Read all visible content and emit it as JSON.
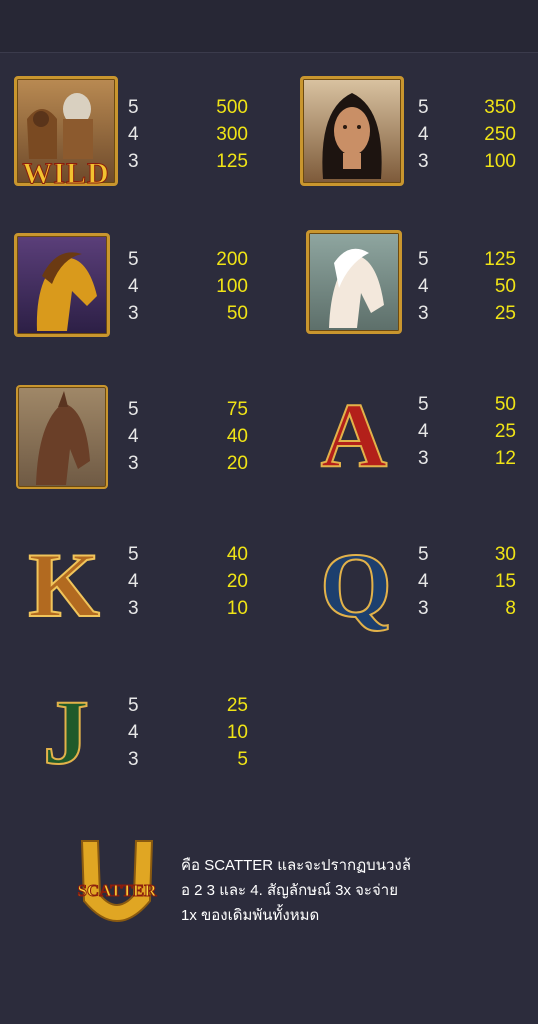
{
  "symbols": [
    {
      "name": "wild",
      "caption": "WILD",
      "pays": [
        {
          "count": "5",
          "value": "500"
        },
        {
          "count": "4",
          "value": "300"
        },
        {
          "count": "3",
          "value": "125"
        }
      ]
    },
    {
      "name": "woman",
      "pays": [
        {
          "count": "5",
          "value": "350"
        },
        {
          "count": "4",
          "value": "250"
        },
        {
          "count": "3",
          "value": "100"
        }
      ]
    },
    {
      "name": "golden-horse",
      "pays": [
        {
          "count": "5",
          "value": "200"
        },
        {
          "count": "4",
          "value": "100"
        },
        {
          "count": "3",
          "value": "50"
        }
      ]
    },
    {
      "name": "white-horse",
      "pays": [
        {
          "count": "5",
          "value": "125"
        },
        {
          "count": "4",
          "value": "50"
        },
        {
          "count": "3",
          "value": "25"
        }
      ]
    },
    {
      "name": "brown-horse",
      "pays": [
        {
          "count": "5",
          "value": "75"
        },
        {
          "count": "4",
          "value": "40"
        },
        {
          "count": "3",
          "value": "20"
        }
      ]
    },
    {
      "name": "letter-a",
      "glyph": "A",
      "pays": [
        {
          "count": "5",
          "value": "50"
        },
        {
          "count": "4",
          "value": "25"
        },
        {
          "count": "3",
          "value": "12"
        }
      ]
    },
    {
      "name": "letter-k",
      "glyph": "K",
      "pays": [
        {
          "count": "5",
          "value": "40"
        },
        {
          "count": "4",
          "value": "20"
        },
        {
          "count": "3",
          "value": "10"
        }
      ]
    },
    {
      "name": "letter-q",
      "glyph": "Q",
      "pays": [
        {
          "count": "5",
          "value": "30"
        },
        {
          "count": "4",
          "value": "15"
        },
        {
          "count": "3",
          "value": "8"
        }
      ]
    },
    {
      "name": "letter-j",
      "glyph": "J",
      "pays": [
        {
          "count": "5",
          "value": "25"
        },
        {
          "count": "4",
          "value": "10"
        },
        {
          "count": "3",
          "value": "5"
        }
      ]
    }
  ],
  "scatter": {
    "caption": "SCATTER",
    "lines": [
      "คือ SCATTER และจะปรากฏบนวงล้",
      "อ 2 3 และ 4. สัญลักษณ์ 3x จะจ่าย",
      "1x ของเดิมพันทั้งหมด"
    ]
  },
  "colors": {
    "background": "#2c2c3c",
    "value": "#f0e416",
    "count": "#e8e8e8",
    "gold": "#c9962e"
  }
}
